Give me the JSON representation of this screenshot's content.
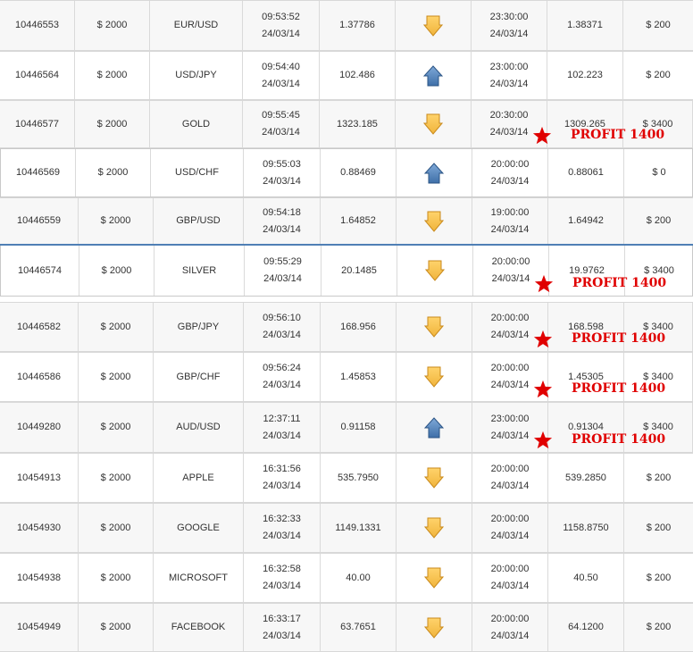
{
  "colors": {
    "accent_blue": "#4f7fb5",
    "profit_red": "#e00000",
    "down_arrow": "#f0b43c",
    "up_arrow": "#3f6fa8"
  },
  "icons": {
    "down": "down-arrow-icon",
    "up": "up-arrow-icon",
    "star": "star-icon"
  },
  "trades": [
    {
      "id": "10446553",
      "amount": "$ 2000",
      "asset": "EUR/USD",
      "open_time": "09:53:52",
      "open_date": "24/03/14",
      "open_rate": "1.37786",
      "direction": "down",
      "expiry_time": "23:30:00",
      "expiry_date": "24/03/14",
      "close_rate": "1.38371",
      "payout": "$ 200"
    },
    {
      "id": "10446564",
      "amount": "$ 2000",
      "asset": "USD/JPY",
      "open_time": "09:54:40",
      "open_date": "24/03/14",
      "open_rate": "102.486",
      "direction": "up",
      "expiry_time": "23:00:00",
      "expiry_date": "24/03/14",
      "close_rate": "102.223",
      "payout": "$ 200"
    },
    {
      "id": "10446577",
      "amount": "$ 2000",
      "asset": "GOLD",
      "open_time": "09:55:45",
      "open_date": "24/03/14",
      "open_rate": "1323.185",
      "direction": "down",
      "expiry_time": "20:30:00",
      "expiry_date": "24/03/14",
      "close_rate": "1309.265",
      "payout": "$ 3400",
      "profit": "PROFIT 1400"
    },
    {
      "id": "10446569",
      "amount": "$ 2000",
      "asset": "USD/CHF",
      "open_time": "09:55:03",
      "open_date": "24/03/14",
      "open_rate": "0.88469",
      "direction": "up",
      "expiry_time": "20:00:00",
      "expiry_date": "24/03/14",
      "close_rate": "0.88061",
      "payout": "$ 0"
    },
    {
      "id": "10446559",
      "amount": "$ 2000",
      "asset": "GBP/USD",
      "open_time": "09:54:18",
      "open_date": "24/03/14",
      "open_rate": "1.64852",
      "direction": "down",
      "expiry_time": "19:00:00",
      "expiry_date": "24/03/14",
      "close_rate": "1.64942",
      "payout": "$ 200"
    },
    {
      "id": "10446574",
      "amount": "$ 2000",
      "asset": "SILVER",
      "open_time": "09:55:29",
      "open_date": "24/03/14",
      "open_rate": "20.1485",
      "direction": "down",
      "expiry_time": "20:00:00",
      "expiry_date": "24/03/14",
      "close_rate": "19.9762",
      "payout": "$ 3400",
      "profit": "PROFIT 1400"
    },
    {
      "id": "10446582",
      "amount": "$ 2000",
      "asset": "GBP/JPY",
      "open_time": "09:56:10",
      "open_date": "24/03/14",
      "open_rate": "168.956",
      "direction": "down",
      "expiry_time": "20:00:00",
      "expiry_date": "24/03/14",
      "close_rate": "168.598",
      "payout": "$ 3400",
      "profit": "PROFIT 1400"
    },
    {
      "id": "10446586",
      "amount": "$ 2000",
      "asset": "GBP/CHF",
      "open_time": "09:56:24",
      "open_date": "24/03/14",
      "open_rate": "1.45853",
      "direction": "down",
      "expiry_time": "20:00:00",
      "expiry_date": "24/03/14",
      "close_rate": "1.45305",
      "payout": "$ 3400",
      "profit": "PROFIT 1400"
    },
    {
      "id": "10449280",
      "amount": "$ 2000",
      "asset": "AUD/USD",
      "open_time": "12:37:11",
      "open_date": "24/03/14",
      "open_rate": "0.91158",
      "direction": "up",
      "expiry_time": "23:00:00",
      "expiry_date": "24/03/14",
      "close_rate": "0.91304",
      "payout": "$ 3400",
      "profit": "PROFIT 1400"
    },
    {
      "id": "10454913",
      "amount": "$ 2000",
      "asset": "APPLE",
      "open_time": "16:31:56",
      "open_date": "24/03/14",
      "open_rate": "535.7950",
      "direction": "down",
      "expiry_time": "20:00:00",
      "expiry_date": "24/03/14",
      "close_rate": "539.2850",
      "payout": "$ 200"
    },
    {
      "id": "10454930",
      "amount": "$ 2000",
      "asset": "GOOGLE",
      "open_time": "16:32:33",
      "open_date": "24/03/14",
      "open_rate": "1149.1331",
      "direction": "down",
      "expiry_time": "20:00:00",
      "expiry_date": "24/03/14",
      "close_rate": "1158.8750",
      "payout": "$ 200"
    },
    {
      "id": "10454938",
      "amount": "$ 2000",
      "asset": "MICROSOFT",
      "open_time": "16:32:58",
      "open_date": "24/03/14",
      "open_rate": "40.00",
      "direction": "down",
      "expiry_time": "20:00:00",
      "expiry_date": "24/03/14",
      "close_rate": "40.50",
      "payout": "$ 200"
    },
    {
      "id": "10454949",
      "amount": "$ 2000",
      "asset": "FACEBOOK",
      "open_time": "16:33:17",
      "open_date": "24/03/14",
      "open_rate": "63.7651",
      "direction": "down",
      "expiry_time": "20:00:00",
      "expiry_date": "24/03/14",
      "close_rate": "64.1200",
      "payout": "$ 200"
    }
  ]
}
